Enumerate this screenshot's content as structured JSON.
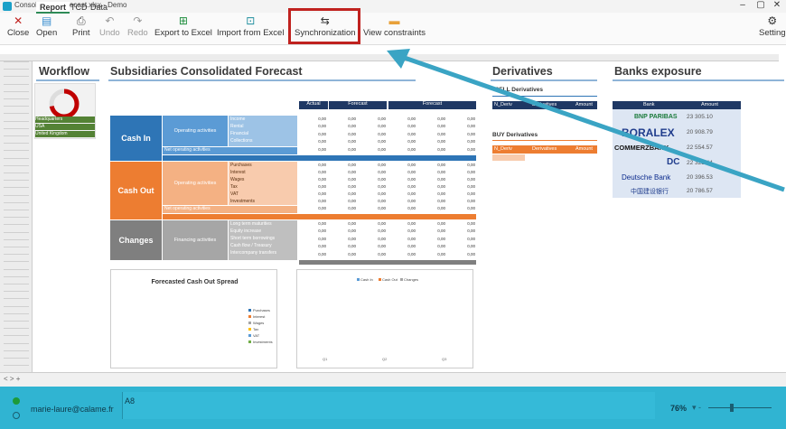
{
  "window": {
    "title": "Consolidated Forecast.xlsx - Demo",
    "minimize": "–",
    "maximize": "▢",
    "close": "✕"
  },
  "ribbon": {
    "close": "Close",
    "open": "Open",
    "print": "Print",
    "undo": "Undo",
    "redo": "Redo",
    "export_excel": "Export to Excel",
    "import_excel": "Import from Excel",
    "synchronization": "Synchronization",
    "view_constraints": "View constraints",
    "settings": "Setting"
  },
  "workflow": {
    "title": "Workflow",
    "items": [
      "Headquarters",
      "USA",
      "United Kingdom"
    ],
    "progress": 0.72
  },
  "forecast": {
    "title": "Subsidiaries Consolidated Forecast",
    "col_headers": [
      "Actual",
      "Forecast",
      "Forecast"
    ],
    "cash_in": {
      "label": "Cash In",
      "group": "Operating activities",
      "rows": [
        "Income",
        "Rental",
        "Financial",
        "Collections"
      ],
      "subtotal": "Net operating activities"
    },
    "cash_out": {
      "label": "Cash Out",
      "group": "Operating activities",
      "rows": [
        "Purchases",
        "Interest",
        "Wages",
        "Tax",
        "VAT",
        "Investments"
      ],
      "subtotal": "Net operating activities"
    },
    "changes": {
      "label": "Changes",
      "group": "Financing activities",
      "rows": [
        "Long term maturities",
        "Equity increase",
        "Short term borrowings",
        "Cash flow / Treasury",
        "Intercompany transfers"
      ]
    },
    "cell_value": "0,00"
  },
  "derivatives": {
    "title": "Derivatives",
    "sell_title": "SELL Derivatives",
    "buy_title": "BUY Derivatives",
    "cols": [
      "N_Deriv",
      "Derivatives",
      "Amount"
    ]
  },
  "banks": {
    "title": "Banks exposure",
    "cols": [
      "Bank",
      "Amount"
    ],
    "rows": [
      {
        "bank": "BNP PARIBAS",
        "amount": "23 305.10"
      },
      {
        "bank": "BORALEX",
        "amount": "20 908.79"
      },
      {
        "bank": "COMMERZBANK",
        "amount": "22 554.57"
      },
      {
        "bank": "DC",
        "amount": "22 325.44"
      },
      {
        "bank": "Deutsche Bank",
        "amount": "20 396.53"
      },
      {
        "bank": "中国建设银行",
        "amount": "20 786.57"
      }
    ]
  },
  "charts": {
    "cash_out_title": "Forecasted Cash Out Spread",
    "cash_out_legend": [
      "Purchases",
      "Interest",
      "Wages",
      "Tax",
      "VAT",
      "Investments"
    ],
    "flow_legend": [
      "Cash In",
      "Cash Out",
      "Changes"
    ],
    "flow_groups": [
      "Q1",
      "Q2",
      "Q3"
    ]
  },
  "sheet_tabs": [
    "Report",
    "TCD",
    "Data"
  ],
  "status": {
    "user": "marie-laure@calame.fr",
    "cell": "A8",
    "zoom": "76%"
  },
  "colors": {
    "accent": "#30b4d2",
    "cash_in": "#2e75b6",
    "cash_out": "#ed7d31",
    "changes": "#7f7f7f",
    "highlight": "#c0221f"
  }
}
